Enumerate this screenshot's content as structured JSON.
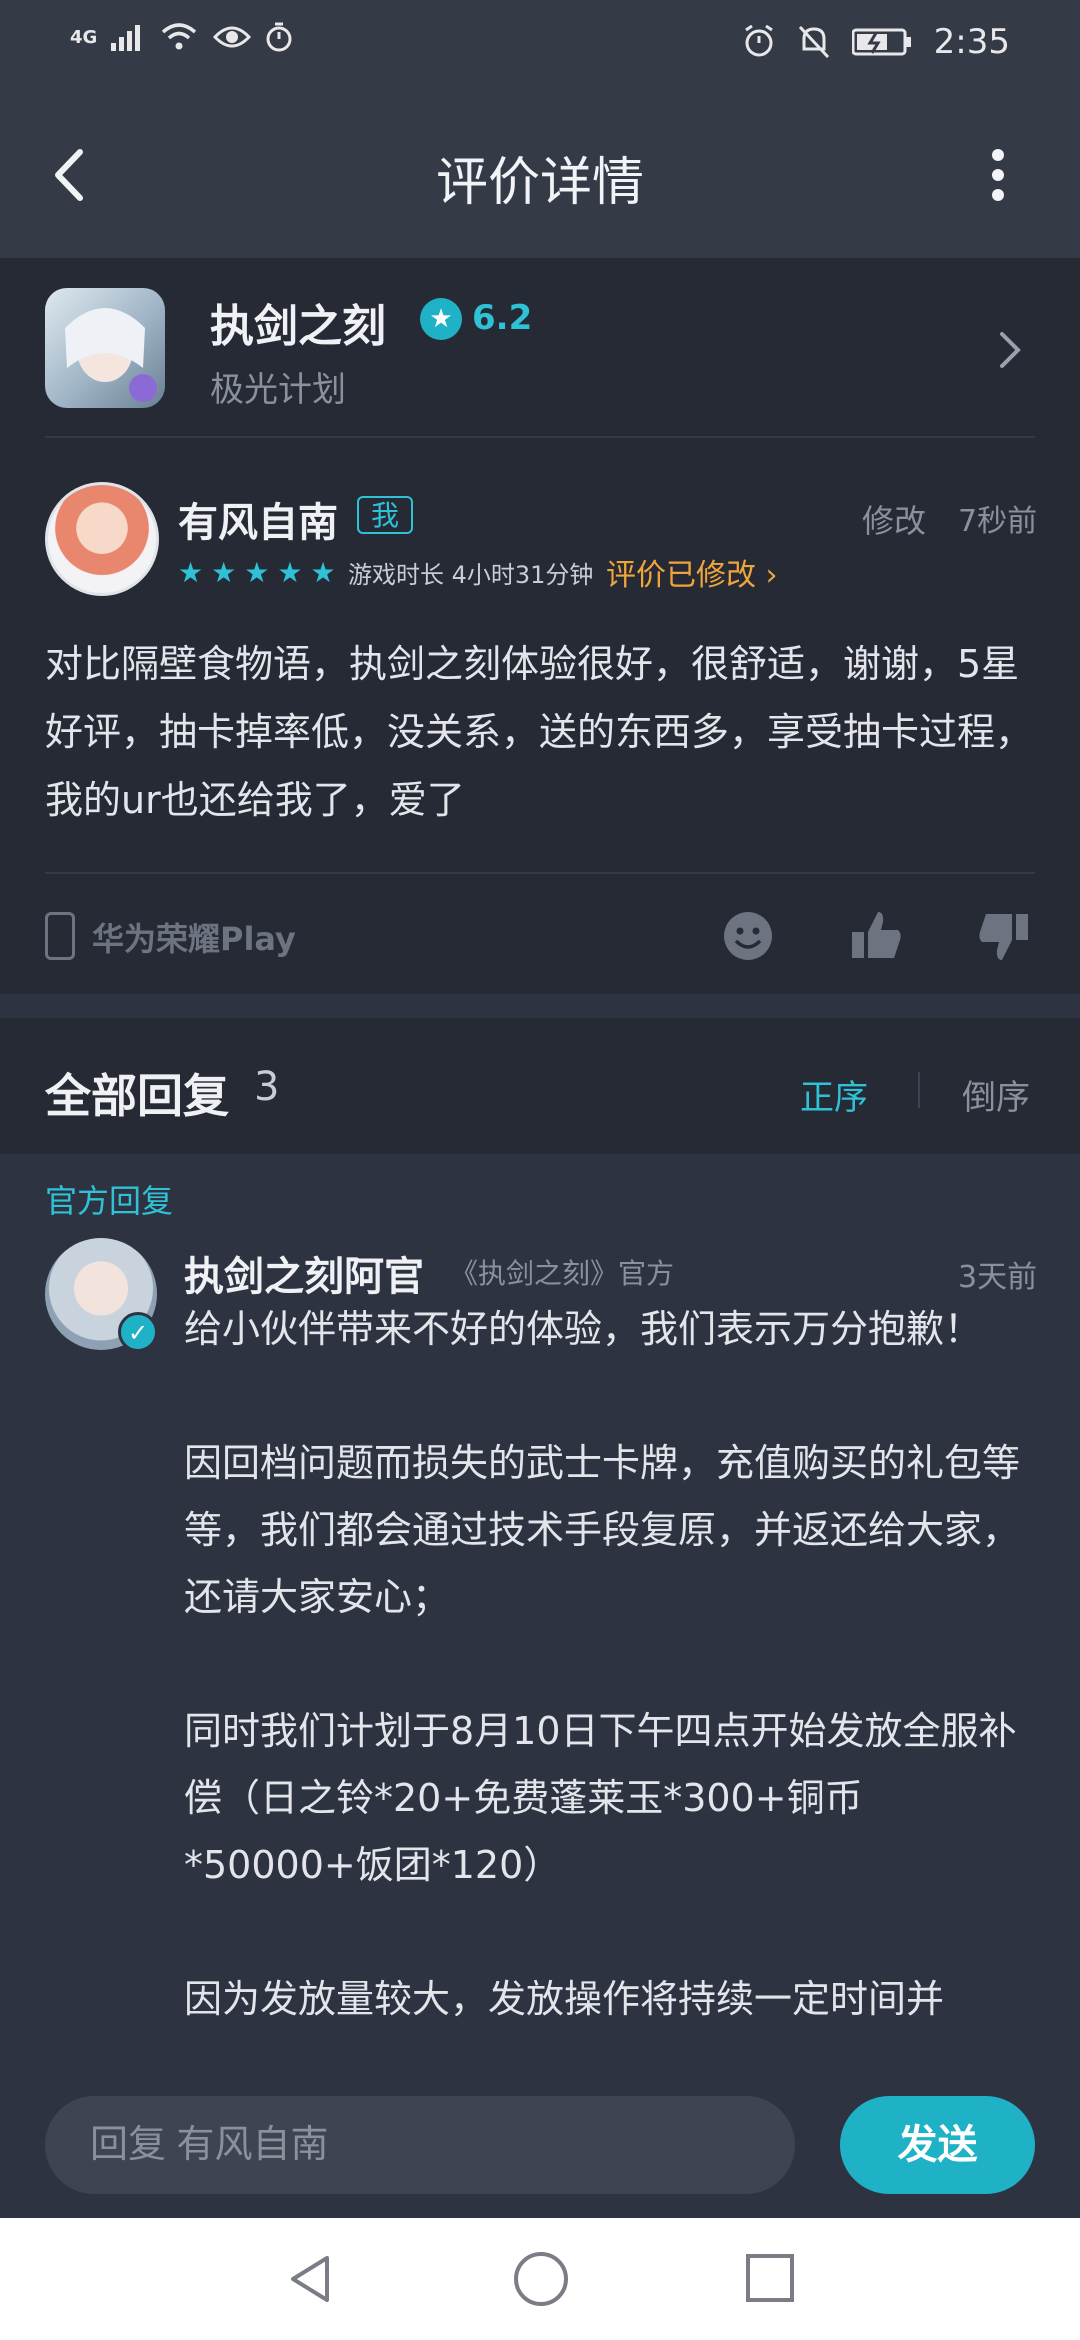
{
  "status_bar": {
    "network": "4G",
    "time": "2:35"
  },
  "header": {
    "title": "评价详情"
  },
  "app": {
    "name": "执剑之刻",
    "rating": "6.2",
    "developer": "极光计划"
  },
  "review": {
    "username": "有风自南",
    "me_badge": "我",
    "modify_label": "修改",
    "time": "7秒前",
    "stars": 5,
    "playtime": "游戏时长 4小时31分钟",
    "edited_label": "评价已修改",
    "text": "对比隔壁食物语，执剑之刻体验很好，很舒适，谢谢，5星好评，抽卡掉率低，没关系，送的东西多，享受抽卡过程，我的ur也还给我了，爱了",
    "device": "华为荣耀Play"
  },
  "replies": {
    "title": "全部回复",
    "count": "3",
    "sort_asc": "正序",
    "sort_desc": "倒序"
  },
  "official_reply": {
    "label": "官方回复",
    "name": "执剑之刻阿官",
    "tag": "《执剑之刻》官方",
    "time": "3天前",
    "text": "给小伙伴带来不好的体验，我们表示万分抱歉！\n\n因回档问题而损失的武士卡牌，充值购买的礼包等等，我们都会通过技术手段复原，并返还给大家，还请大家安心；\n\n同时我们计划于8月10日下午四点开始发放全服补偿（日之铃*20+免费蓬莱玉*300+铜币*50000+饭团*120）\n\n因为发放量较大，发放操作将持续一定时间并"
  },
  "input": {
    "placeholder": "回复 有风自南",
    "send_label": "发送"
  },
  "colors": {
    "accent": "#1fb2c6",
    "warning": "#f0a53a",
    "background": "#2e3342",
    "card": "#262a35"
  }
}
